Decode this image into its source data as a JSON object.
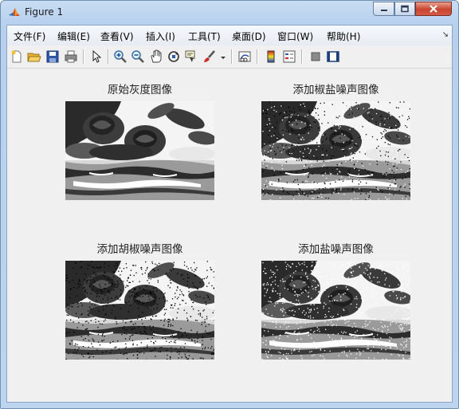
{
  "window": {
    "title": "Figure 1",
    "app_icon": "matlab-icon",
    "controls": [
      "minimize-icon",
      "maximize-icon",
      "close-icon"
    ]
  },
  "menu": [
    {
      "label": "文件(F)"
    },
    {
      "label": "编辑(E)"
    },
    {
      "label": "查看(V)"
    },
    {
      "label": "插入(I)"
    },
    {
      "label": "工具(T)"
    },
    {
      "label": "桌面(D)"
    },
    {
      "label": "窗口(W)"
    },
    {
      "label": "帮助(H)"
    }
  ],
  "toolbar": [
    "new-figure-icon",
    "open-file-icon",
    "save-icon",
    "print-icon",
    "pointer-icon",
    "zoom-in-icon",
    "zoom-out-icon",
    "pan-icon",
    "rotate-3d-icon",
    "data-cursor-icon",
    "brush-icon",
    "link-plot-icon",
    "colorbar-icon",
    "legend-icon",
    "hide-plot-tools-icon",
    "show-plot-tools-icon"
  ],
  "subplots": [
    {
      "title": "原始灰度图像",
      "noise": "none"
    },
    {
      "title": "添加椒盐噪声图像",
      "noise": "salt-and-pepper"
    },
    {
      "title": "添加胡椒噪声图像",
      "noise": "pepper"
    },
    {
      "title": "添加盐噪声图像",
      "noise": "salt"
    }
  ],
  "colors": {
    "figure_bg": "#f0f0f0",
    "title_bar": "#c4d9f1",
    "close_button": "#c8442f"
  }
}
